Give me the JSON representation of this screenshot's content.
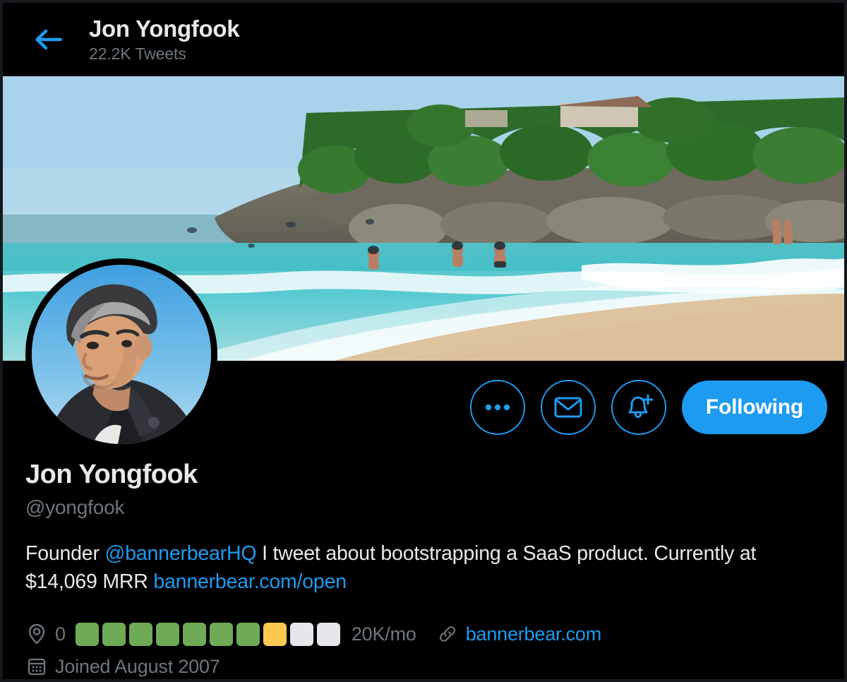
{
  "header": {
    "back_icon": "arrow-left-icon",
    "name": "Jon Yongfook",
    "tweets": "22.2K Tweets"
  },
  "banner": {
    "alt": "tropical beach with turquoise water, swimmers, rocky green headland and sand"
  },
  "avatar": {
    "alt": "portrait of man with grey hair in dark coat against blue sky"
  },
  "actions": {
    "more_icon": "ellipsis-icon",
    "message_icon": "envelope-icon",
    "notify_icon": "bell-plus-icon",
    "follow_label": "Following"
  },
  "profile": {
    "display_name": "Jon Yongfook",
    "handle": "@yongfook"
  },
  "bio": {
    "part1": "Founder ",
    "mention": "@bannerbearHQ",
    "part2": " I tweet about bootstrapping a SaaS product. Currently at $14,069 MRR ",
    "link": "bannerbear.com/open"
  },
  "meta": {
    "location_icon": "location-pin-icon",
    "location": "0",
    "rate": "20K/mo",
    "link_icon": "link-chain-icon",
    "website": "bannerbear.com",
    "calendar_icon": "calendar-icon",
    "joined": "Joined August 2007"
  },
  "chart_data": {
    "type": "bar",
    "title": "MRR progress segments",
    "segments_total": 10,
    "filled": 7,
    "partial": 1,
    "empty": 2,
    "goal_label": "20K/mo",
    "colors": {
      "filled": "#6faa56",
      "partial": "#fbc94e",
      "empty": "#e5e7ea"
    },
    "states": [
      "full",
      "full",
      "full",
      "full",
      "full",
      "full",
      "full",
      "part",
      "empty",
      "empty"
    ]
  },
  "colors": {
    "accent": "#1d9bf0",
    "background": "#000000",
    "text": "#e7e9ea",
    "muted": "#6e767d"
  }
}
